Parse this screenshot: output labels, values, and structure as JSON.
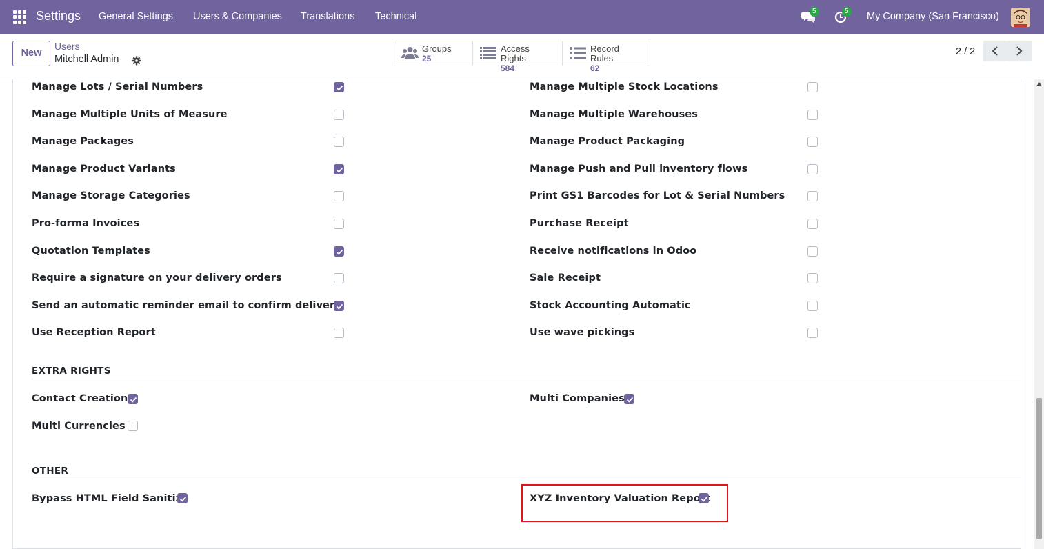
{
  "navbar": {
    "app_title": "Settings",
    "menu": [
      "General Settings",
      "Users & Companies",
      "Translations",
      "Technical"
    ],
    "messages_badge": "5",
    "activities_badge": "5",
    "company": "My Company (San Francisco)"
  },
  "controlbar": {
    "new_label": "New",
    "breadcrumb": "Users",
    "record_name": "Mitchell Admin",
    "smart_buttons": [
      {
        "label": "Groups",
        "value": "25",
        "icon": "users-icon"
      },
      {
        "label": "Access Rights",
        "value": "584",
        "icon": "list-icon"
      },
      {
        "label": "Record Rules",
        "value": "62",
        "icon": "list-icon"
      }
    ],
    "pager": "2 / 2"
  },
  "technical_rights": {
    "left": [
      {
        "label": "Manage Lots / Serial Numbers",
        "checked": true
      },
      {
        "label": "Manage Multiple Units of Measure",
        "checked": false
      },
      {
        "label": "Manage Packages",
        "checked": false
      },
      {
        "label": "Manage Product Variants",
        "checked": true
      },
      {
        "label": "Manage Storage Categories",
        "checked": false
      },
      {
        "label": "Pro-forma Invoices",
        "checked": false
      },
      {
        "label": "Quotation Templates",
        "checked": true
      },
      {
        "label": "Require a signature on your delivery orders",
        "checked": false
      },
      {
        "label": "Send an automatic reminder email to confirm delivery",
        "checked": true
      },
      {
        "label": "Use Reception Report",
        "checked": false
      }
    ],
    "right": [
      {
        "label": "Manage Multiple Stock Locations",
        "checked": false
      },
      {
        "label": "Manage Multiple Warehouses",
        "checked": false
      },
      {
        "label": "Manage Product Packaging",
        "checked": false
      },
      {
        "label": "Manage Push and Pull inventory flows",
        "checked": false
      },
      {
        "label": "Print GS1 Barcodes for Lot & Serial Numbers",
        "checked": false
      },
      {
        "label": "Purchase Receipt",
        "checked": false
      },
      {
        "label": "Receive notifications in Odoo",
        "checked": false
      },
      {
        "label": "Sale Receipt",
        "checked": false
      },
      {
        "label": "Stock Accounting Automatic",
        "checked": false
      },
      {
        "label": "Use wave pickings",
        "checked": false
      }
    ]
  },
  "extra_rights": {
    "title": "EXTRA RIGHTS",
    "items": [
      {
        "label": "Contact Creation",
        "checked": true
      },
      {
        "label": "Multi Currencies",
        "checked": false
      },
      {
        "label": "Multi Companies",
        "checked": true
      }
    ]
  },
  "other": {
    "title": "OTHER",
    "items": [
      {
        "label": "Bypass HTML Field Sanitize",
        "checked": true
      },
      {
        "label": "XYZ Inventory Valuation Report",
        "checked": true
      }
    ]
  },
  "colors": {
    "brand": "#71639e",
    "highlight": "#e3131c",
    "badge": "#28a745"
  }
}
